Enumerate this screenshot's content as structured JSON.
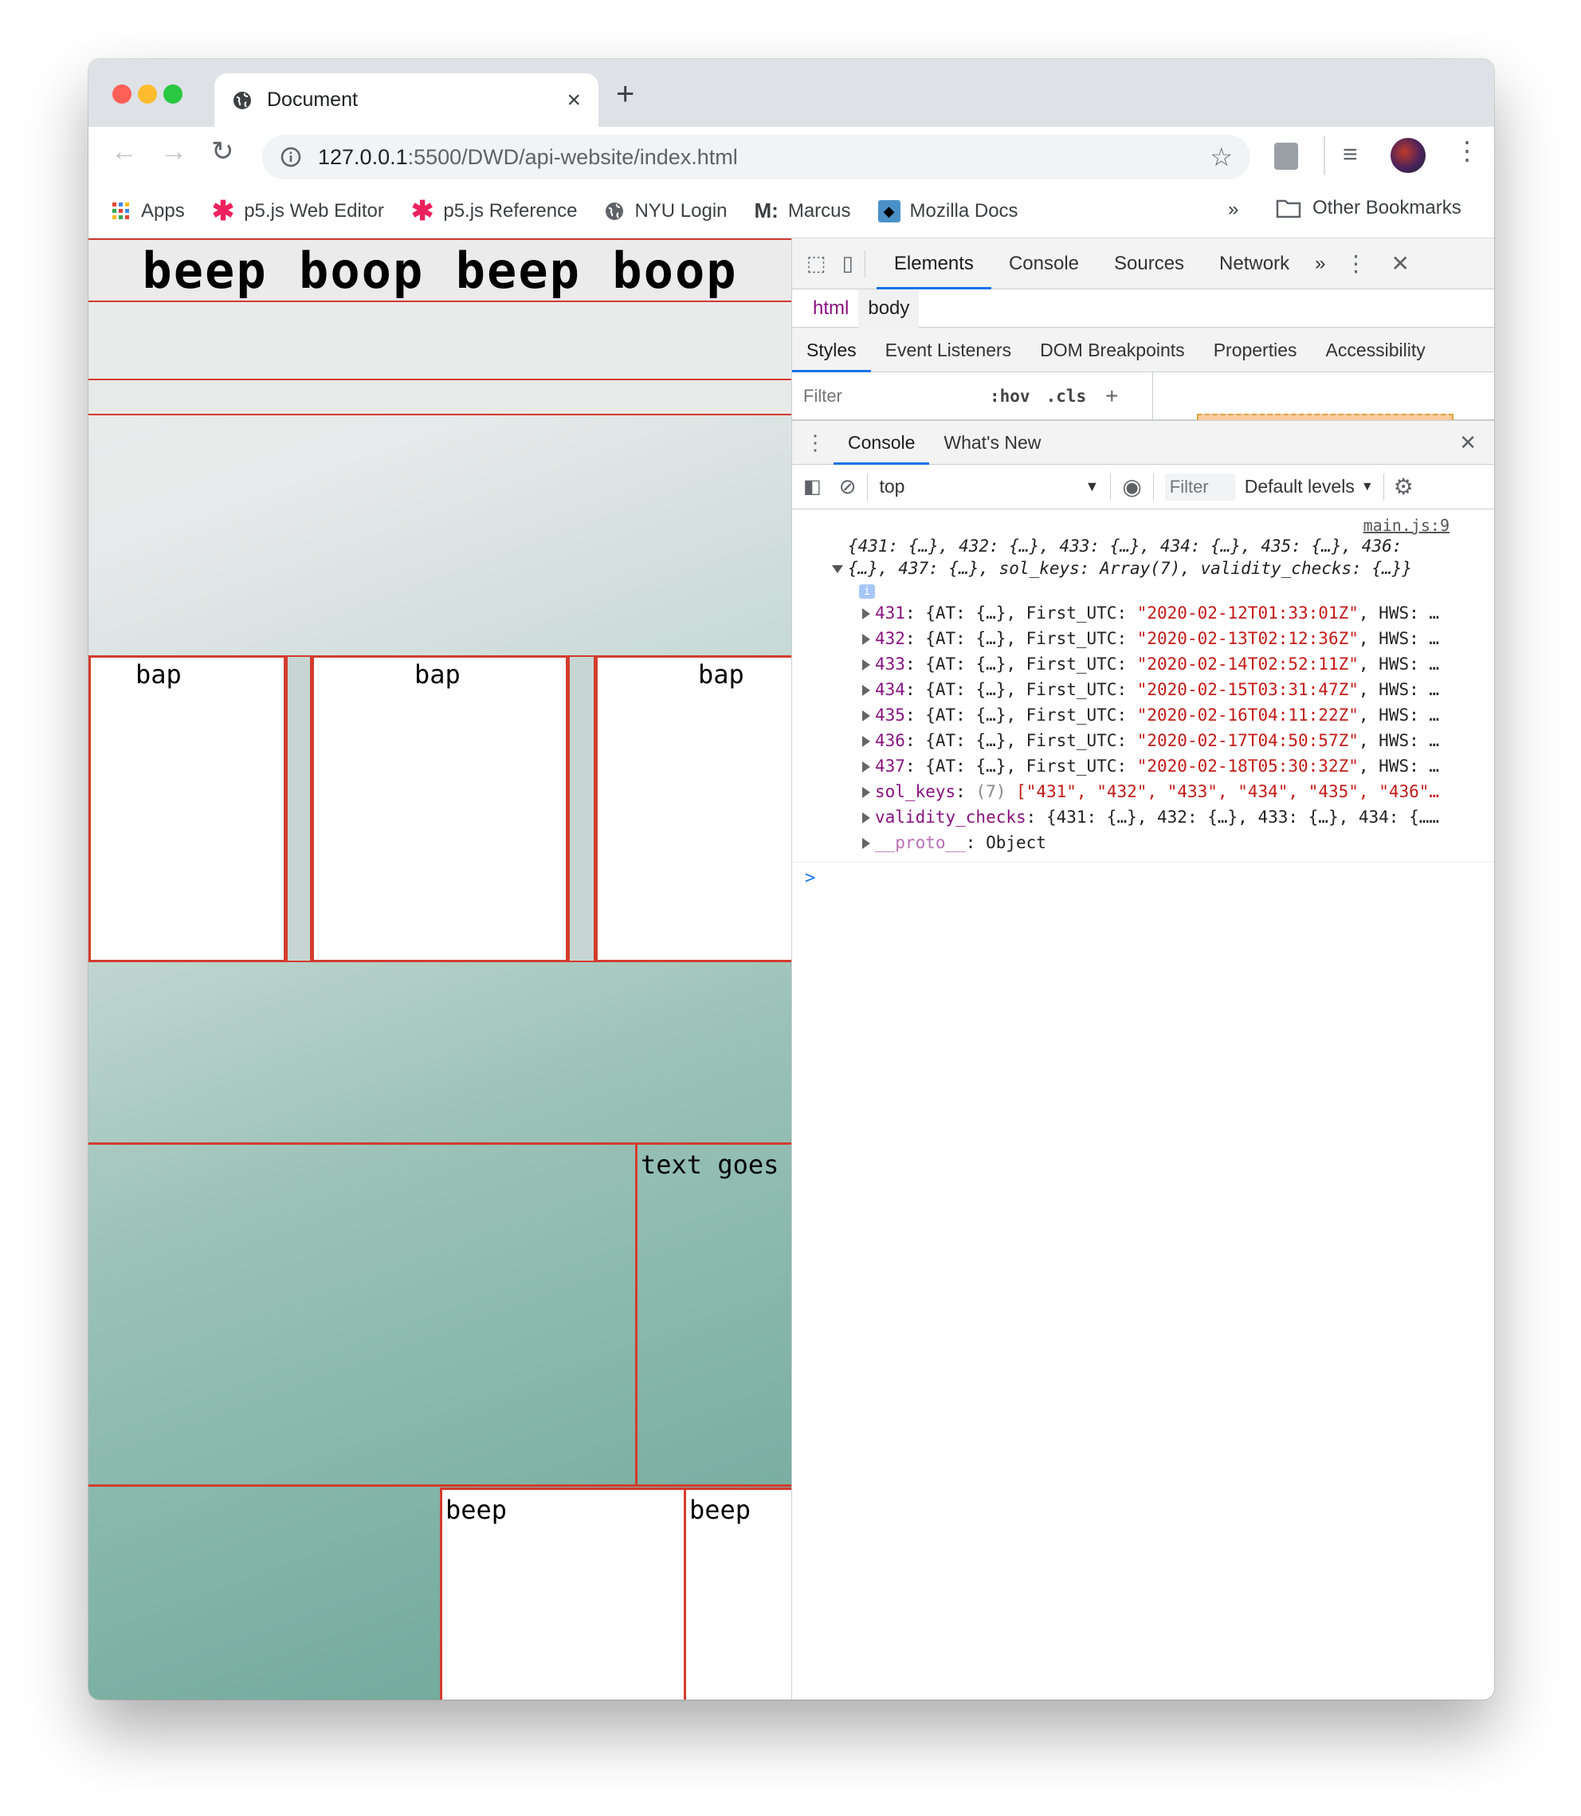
{
  "browser": {
    "tab_title": "Document",
    "tab_close": "×",
    "new_tab": "+",
    "url_host": "127.0.0.1",
    "url_rest": ":5500/DWD/api-website/index.html",
    "bookmarks": [
      {
        "label": "Apps",
        "icon": "apps-grid-icon"
      },
      {
        "label": "p5.js Web Editor",
        "icon": "asterisk-icon"
      },
      {
        "label": "p5.js Reference",
        "icon": "asterisk-icon"
      },
      {
        "label": "NYU Login",
        "icon": "globe-icon"
      },
      {
        "label": "Marcus",
        "icon": "medium-m-icon",
        "prefix": "M:"
      },
      {
        "label": "Mozilla Docs",
        "icon": "mozilla-icon"
      }
    ],
    "bookmarks_more": "»",
    "other_bookmarks": "Other Bookmarks"
  },
  "page": {
    "heading": "beep boop beep boop",
    "boxes_row1": [
      "bap",
      "bap",
      "bap"
    ],
    "text_box": "text goes",
    "boxes_row3": [
      "beep",
      "beep"
    ]
  },
  "devtools": {
    "tabs": [
      "Elements",
      "Console",
      "Sources",
      "Network"
    ],
    "tabs_more": "»",
    "breadcrumbs": [
      "html",
      "body"
    ],
    "subtabs": [
      "Styles",
      "Event Listeners",
      "DOM Breakpoints",
      "Properties",
      "Accessibility"
    ],
    "filter_placeholder": "Filter",
    "hov": ":hov",
    "cls": ".cls",
    "drawer_tabs": [
      "Console",
      "What's New"
    ],
    "context": "top",
    "console_filter_placeholder": "Filter",
    "levels": "Default levels",
    "source_link": "main.js:9",
    "summary_line1": "{431: {…}, 432: {…}, 433: {…}, 434: {…}, 435: {…}, 436:",
    "summary_line2": "{…}, 437: {…}, sol_keys: Array(7), validity_checks: {…}}",
    "info_badge": "i",
    "entries": [
      {
        "key": "431",
        "pre": ": {AT: {…}, First_UTC: ",
        "val": "\"2020-02-12T01:33:01Z\"",
        "post": ", HWS: …"
      },
      {
        "key": "432",
        "pre": ": {AT: {…}, First_UTC: ",
        "val": "\"2020-02-13T02:12:36Z\"",
        "post": ", HWS: …"
      },
      {
        "key": "433",
        "pre": ": {AT: {…}, First_UTC: ",
        "val": "\"2020-02-14T02:52:11Z\"",
        "post": ", HWS: …"
      },
      {
        "key": "434",
        "pre": ": {AT: {…}, First_UTC: ",
        "val": "\"2020-02-15T03:31:47Z\"",
        "post": ", HWS: …"
      },
      {
        "key": "435",
        "pre": ": {AT: {…}, First_UTC: ",
        "val": "\"2020-02-16T04:11:22Z\"",
        "post": ", HWS: …"
      },
      {
        "key": "436",
        "pre": ": {AT: {…}, First_UTC: ",
        "val": "\"2020-02-17T04:50:57Z\"",
        "post": ", HWS: …"
      },
      {
        "key": "437",
        "pre": ": {AT: {…}, First_UTC: ",
        "val": "\"2020-02-18T05:30:32Z\"",
        "post": ", HWS: …"
      }
    ],
    "sol_keys_key": "sol_keys",
    "sol_keys_count": "(7)",
    "sol_keys_values": "[\"431\", \"432\", \"433\", \"434\", \"435\", \"436\"…",
    "validity_key": "validity_checks",
    "validity_value": ": {431: {…}, 432: {…}, 433: {…}, 434: {……",
    "proto_key": "__proto__",
    "proto_value": ": Object",
    "prompt": ">"
  },
  "colors": {
    "accent_red": "#d33c2e",
    "devtools_blue": "#1a73e8",
    "console_key": "#881280",
    "console_string": "#c41a16"
  }
}
